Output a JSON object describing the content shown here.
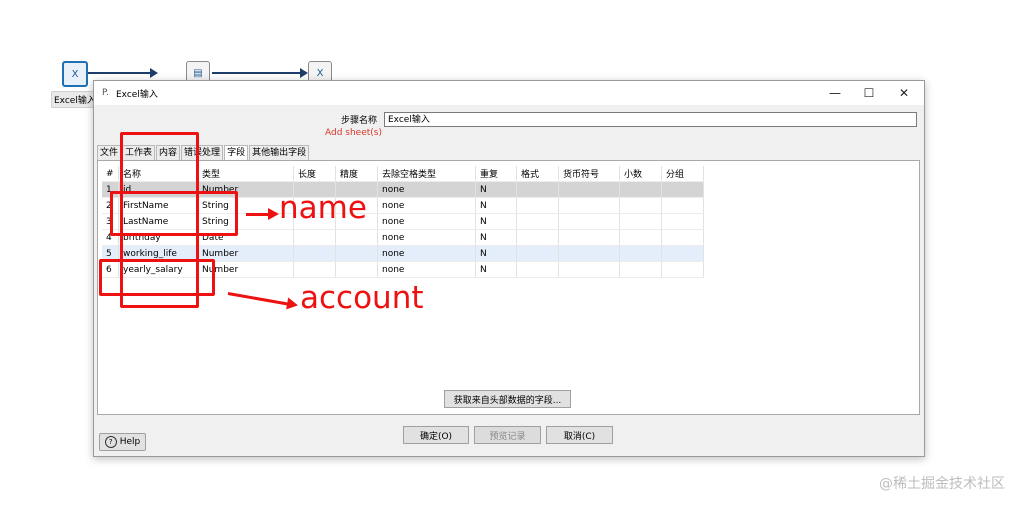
{
  "canvas": {
    "steps": [
      {
        "name": "Excel输入",
        "icon": "excel-input-icon"
      },
      {
        "name": "",
        "icon": "table-icon"
      },
      {
        "name": "",
        "icon": "excel-output-icon"
      }
    ]
  },
  "dialog": {
    "title": "Excel输入",
    "window_controls": {
      "minimize": "—",
      "maximize": "☐",
      "close": "✕"
    },
    "step_name_label": "步骤名称",
    "step_name_value": "Excel输入",
    "add_sheets_label": "Add sheet(s)",
    "tabs": [
      "文件",
      "工作表",
      "内容",
      "错误处理",
      "字段",
      "其他输出字段"
    ],
    "active_tab": 4,
    "table": {
      "columns": [
        "#",
        "名称",
        "类型",
        "长度",
        "精度",
        "去除空格类型",
        "重复",
        "格式",
        "货币符号",
        "小数",
        "分组"
      ],
      "rows": [
        {
          "num": "1",
          "name": "id",
          "type": "Number",
          "length": "",
          "precision": "",
          "trim": "none",
          "repeat": "N"
        },
        {
          "num": "2",
          "name": "FirstName",
          "type": "String",
          "length": "",
          "precision": "",
          "trim": "none",
          "repeat": "N"
        },
        {
          "num": "3",
          "name": "LastName",
          "type": "String",
          "length": "",
          "precision": "",
          "trim": "none",
          "repeat": "N"
        },
        {
          "num": "4",
          "name": "brithday",
          "type": "Date",
          "length": "",
          "precision": "",
          "trim": "none",
          "repeat": "N"
        },
        {
          "num": "5",
          "name": "working_life",
          "type": "Number",
          "length": "",
          "precision": "",
          "trim": "none",
          "repeat": "N"
        },
        {
          "num": "6",
          "name": "yearly_salary",
          "type": "Number",
          "length": "",
          "precision": "",
          "trim": "none",
          "repeat": "N"
        }
      ]
    },
    "get_fields_button": "获取来自头部数据的字段...",
    "help_button": "Help",
    "ok_button": "确定(O)",
    "preview_button": "预览记录",
    "cancel_button": "取消(C)"
  },
  "annotations": {
    "name_label": "name",
    "account_label": "account",
    "color": "#ee1111"
  },
  "watermark": "@稀土掘金技术社区"
}
